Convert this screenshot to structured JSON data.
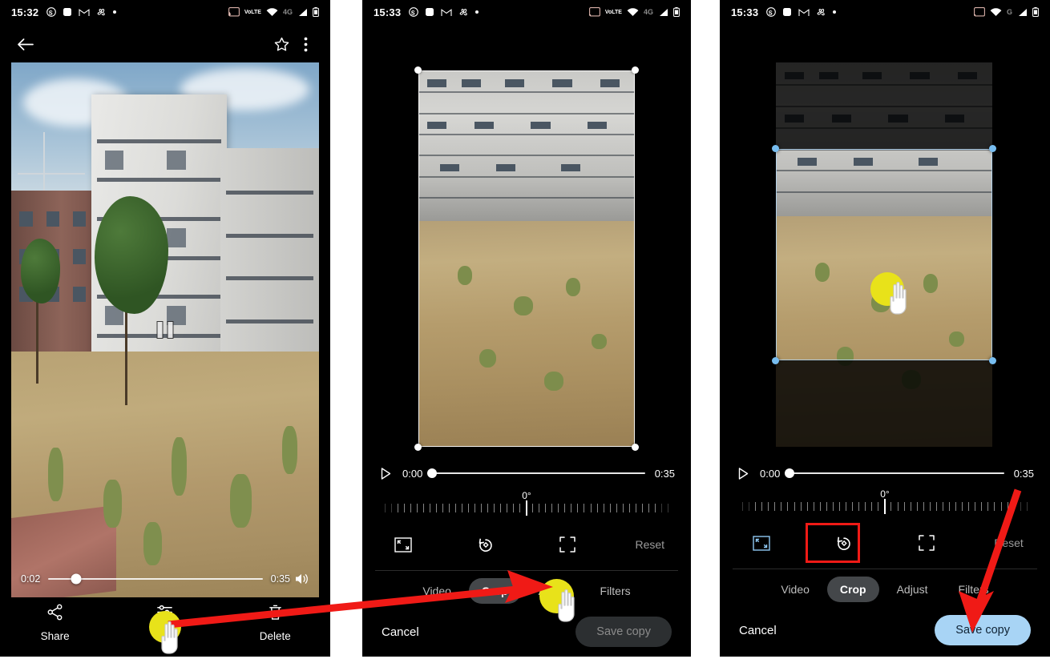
{
  "panels": [
    {
      "id": "photo-viewer",
      "status": {
        "time": "15:32",
        "left_icons": [
          "skype-icon",
          "square-app-icon",
          "gmail-icon",
          "pinwheel-icon",
          "dot-icon"
        ],
        "right_icons": [
          "cast-icon",
          "volte-icon",
          "wifi-icon",
          "4g-icon",
          "signal-icon",
          "battery-icon"
        ],
        "volte_label": "VoLTE",
        "net_label": "4G"
      },
      "appbar": {
        "back_icon": "back-arrow-icon",
        "star_icon": "star-outline-icon",
        "more_icon": "overflow-menu-icon"
      },
      "video": {
        "current_time": "0:02",
        "total_time": "0:35",
        "volume_icon": "volume-on-icon",
        "state_icon": "pause-icon",
        "progress_percent": 13
      },
      "actions": [
        {
          "label": "Share",
          "icon": "share-icon"
        },
        {
          "label": "Edit",
          "icon": "edit-icon"
        },
        {
          "label": "Delete",
          "icon": "trash-icon"
        }
      ]
    },
    {
      "id": "editor-crop-before",
      "status": {
        "time": "15:33",
        "left_icons": [
          "skype-icon",
          "square-app-icon",
          "gmail-icon",
          "pinwheel-icon",
          "dot-icon"
        ],
        "right_icons": [
          "cast-icon",
          "volte-icon",
          "wifi-icon",
          "4g-icon",
          "signal-icon",
          "battery-icon"
        ],
        "volte_label": "VoLTE",
        "net_label": "4G"
      },
      "video": {
        "play_icon": "play-icon",
        "current_time": "0:00",
        "total_time": "0:35",
        "progress_percent": 0
      },
      "rotation": {
        "degrees": "0°"
      },
      "tools": [
        {
          "name": "aspect-ratio-tool",
          "icon": "aspect-ratio-icon",
          "selected": false
        },
        {
          "name": "rotate-tool",
          "icon": "rotate-left-icon",
          "selected": false
        },
        {
          "name": "perspective-tool",
          "icon": "expand-corners-icon",
          "selected": false
        },
        {
          "name": "reset-tool",
          "label": "Reset"
        }
      ],
      "tabs": [
        {
          "label": "Video",
          "active": false
        },
        {
          "label": "Crop",
          "active": true
        },
        {
          "label": "Adjust",
          "active": false
        },
        {
          "label": "Filters",
          "active": false
        }
      ],
      "footer": {
        "cancel": "Cancel",
        "save": "Save copy",
        "save_enabled": false
      }
    },
    {
      "id": "editor-crop-after",
      "status": {
        "time": "15:33",
        "left_icons": [
          "skype-icon",
          "square-app-icon",
          "gmail-icon",
          "pinwheel-icon",
          "dot-icon"
        ],
        "right_icons": [
          "cast-icon",
          "wifi-icon",
          "g-icon",
          "signal-icon",
          "battery-icon"
        ],
        "volte_label": "",
        "net_label": "G"
      },
      "video": {
        "play_icon": "play-icon",
        "current_time": "0:00",
        "total_time": "0:35",
        "progress_percent": 0
      },
      "rotation": {
        "degrees": "0°"
      },
      "tools": [
        {
          "name": "aspect-ratio-tool",
          "icon": "aspect-ratio-icon",
          "selected": true
        },
        {
          "name": "rotate-tool",
          "icon": "rotate-left-icon",
          "selected": false
        },
        {
          "name": "perspective-tool",
          "icon": "expand-corners-icon",
          "selected": false
        },
        {
          "name": "reset-tool",
          "label": "Reset"
        }
      ],
      "tabs": [
        {
          "label": "Video",
          "active": false
        },
        {
          "label": "Crop",
          "active": true
        },
        {
          "label": "Adjust",
          "active": false
        },
        {
          "label": "Filters",
          "active": false
        }
      ],
      "footer": {
        "cancel": "Cancel",
        "save": "Save copy",
        "save_enabled": true
      }
    }
  ],
  "annotations": {
    "arrow_color": "#f01a16",
    "highlight_color": "#e8e21a",
    "selection_box_color": "#f01a16",
    "tap_targets": [
      "edit-button",
      "crop-tab",
      "crop-area-drag"
    ]
  }
}
